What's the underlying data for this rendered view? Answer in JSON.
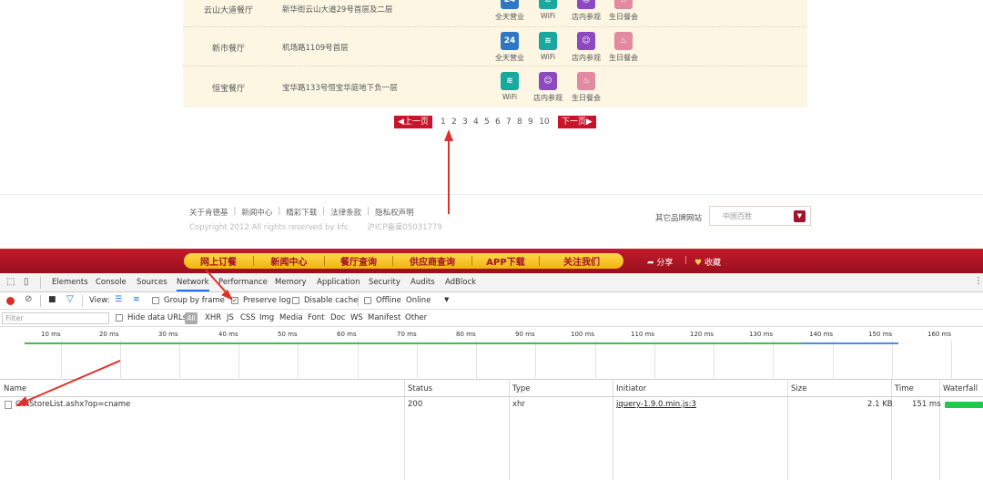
{
  "stores": [
    {
      "name": "云山大道餐厅",
      "address": "新华街云山大道29号首层及二层",
      "services": [
        "全天营业",
        "WiFi",
        "店内参观",
        "生日餐会"
      ]
    },
    {
      "name": "新市餐厅",
      "address": "机场路1109号首层",
      "services": [
        "全天营业",
        "WiFi",
        "店内参观",
        "生日餐会"
      ]
    },
    {
      "name": "恒宝餐厅",
      "address": "宝华路133号恒宝华庭地下负一层",
      "services": [
        "WiFi",
        "店内参观",
        "生日餐会"
      ]
    }
  ],
  "pagination": {
    "prev": "◀上一页",
    "next": "下一页▶",
    "pages": [
      "1",
      "2",
      "3",
      "4",
      "5",
      "6",
      "7",
      "8",
      "9",
      "10"
    ],
    "current": "2"
  },
  "footer": {
    "links": [
      "关于肯德基",
      "新闻中心",
      "精彩下载",
      "法律条款",
      "隐私权声明"
    ],
    "copyright": "Copyright 2012 All rights reserved by kfc.",
    "icp": "沪ICP备案05031779",
    "brand_label": "其它品牌网站",
    "brand_select": "中国百胜"
  },
  "nav": {
    "items": [
      "网上订餐",
      "新闻中心",
      "餐厅查询",
      "供应商查询",
      "APP下载",
      "关注我们"
    ],
    "share": "分享",
    "favorite": "收藏"
  },
  "devtools": {
    "tabs": [
      "Elements",
      "Console",
      "Sources",
      "Network",
      "Performance",
      "Memory",
      "Application",
      "Security",
      "Audits",
      "AdBlock"
    ],
    "active_tab": "Network",
    "toolbar": {
      "view_label": "View:",
      "group_by_frame": "Group by frame",
      "preserve_log": "Preserve log",
      "disable_cache": "Disable cache",
      "offline": "Offline",
      "throttle": "Online"
    },
    "filter": {
      "placeholder": "Filter",
      "hide_data_urls": "Hide data URLs",
      "types": [
        "All",
        "XHR",
        "JS",
        "CSS",
        "Img",
        "Media",
        "Font",
        "Doc",
        "WS",
        "Manifest",
        "Other"
      ]
    },
    "timeline_ticks": [
      "10 ms",
      "20 ms",
      "30 ms",
      "40 ms",
      "50 ms",
      "60 ms",
      "70 ms",
      "80 ms",
      "90 ms",
      "100 ms",
      "110 ms",
      "120 ms",
      "130 ms",
      "140 ms",
      "150 ms",
      "160 ms"
    ],
    "columns": [
      "Name",
      "Status",
      "Type",
      "Initiator",
      "Size",
      "Time",
      "Waterfall"
    ],
    "rows": [
      {
        "name": "GetStoreList.ashx?op=cname",
        "status": "200",
        "type": "xhr",
        "initiator": "jquery-1.9.0.min.js:3",
        "size": "2.1 KB",
        "time": "151 ms"
      }
    ]
  }
}
